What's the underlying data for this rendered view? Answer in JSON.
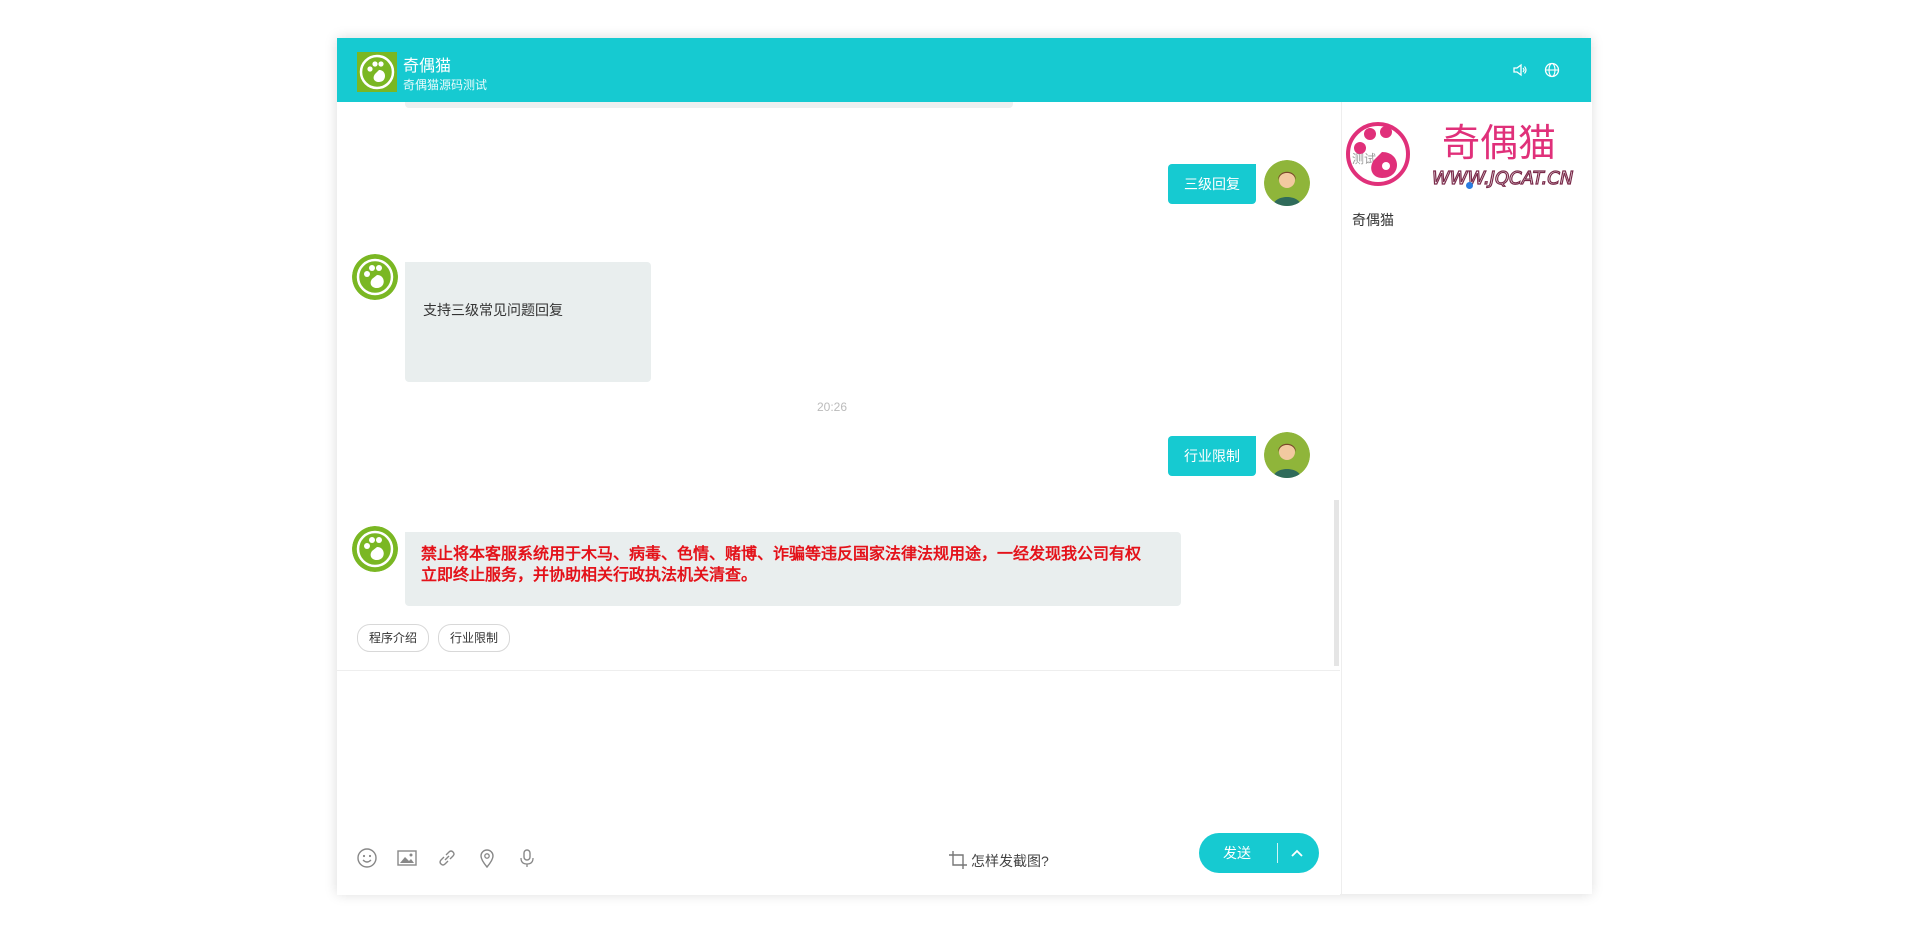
{
  "header": {
    "title": "奇偶猫",
    "subtitle": "奇偶猫源码测试",
    "icons": [
      "speaker-icon",
      "globe-icon"
    ]
  },
  "messages": [
    {
      "from": "user",
      "text": "三级回复"
    },
    {
      "from": "bot",
      "text": "支持三级常见问题回复"
    },
    {
      "type": "time",
      "text": "20:26"
    },
    {
      "from": "user",
      "text": "行业限制"
    },
    {
      "from": "bot",
      "text": "禁止将本客服系统用于木马、病毒、色情、赌博、诈骗等违反国家法律法规用途，一经发现我公司有权立即终止服务，并协助相关行政执法机关清查。"
    }
  ],
  "quick_replies": [
    "程序介绍",
    "行业限制"
  ],
  "toolbar": {
    "tools": [
      "emoji-icon",
      "image-icon",
      "link-icon",
      "location-icon",
      "microphone-icon"
    ],
    "capture_hint": "怎样发截图?",
    "send_label": "发送"
  },
  "sidebar": {
    "logo_text": "奇偶猫",
    "logo_url_text": "WWW.JQCAT.CN",
    "tab_label": "测试",
    "agent_name": "奇偶猫"
  },
  "colors": {
    "accent": "#16cad1",
    "bot_avatar": "#7ab723",
    "warning_text": "#e4121a",
    "logo_pink": "#e0307a"
  }
}
